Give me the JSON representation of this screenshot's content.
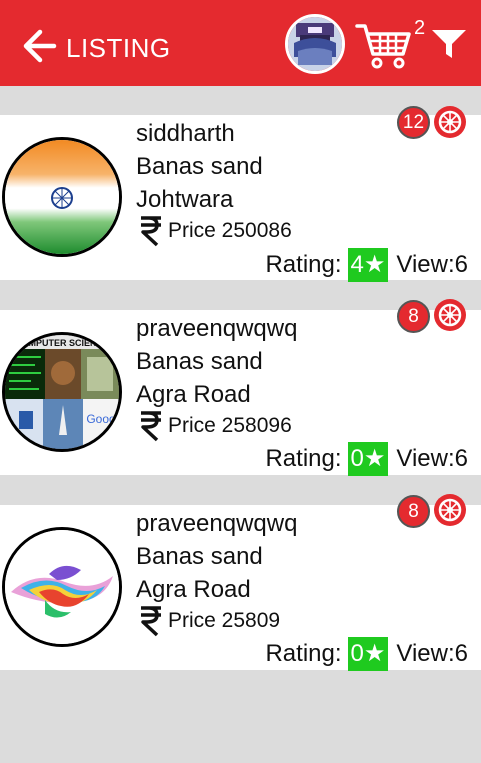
{
  "header": {
    "title": "LISTING",
    "cart_count": "2",
    "accent_color": "#e42a2f"
  },
  "listings": [
    {
      "name": "siddharth",
      "category": "Banas sand",
      "location": "Johtwara",
      "price": "Price 250086",
      "badge_count": "12",
      "rating_label": "Rating:",
      "rating": "4★",
      "views": "View:6",
      "thumbnail": "indian-flag-image"
    },
    {
      "name": "praveenqwqwq",
      "category": "Banas sand",
      "location": "Agra Road",
      "price": "Price 258096",
      "badge_count": "8",
      "rating_label": "Rating:",
      "rating": "0★",
      "views": "View:6",
      "thumbnail": "computer-science-collage-image"
    },
    {
      "name": "praveenqwqwq",
      "category": "Banas sand",
      "location": "Agra Road",
      "price": "Price 25809",
      "badge_count": "8",
      "rating_label": "Rating:",
      "rating": "0★",
      "views": "View:6",
      "thumbnail": "colorful-paint-splash-image"
    }
  ],
  "icons": {
    "back": "arrow-left-icon",
    "cart": "shopping-cart-icon",
    "filter": "filter-funnel-icon",
    "currency": "rupee-icon",
    "wheel": "wheel-icon"
  }
}
